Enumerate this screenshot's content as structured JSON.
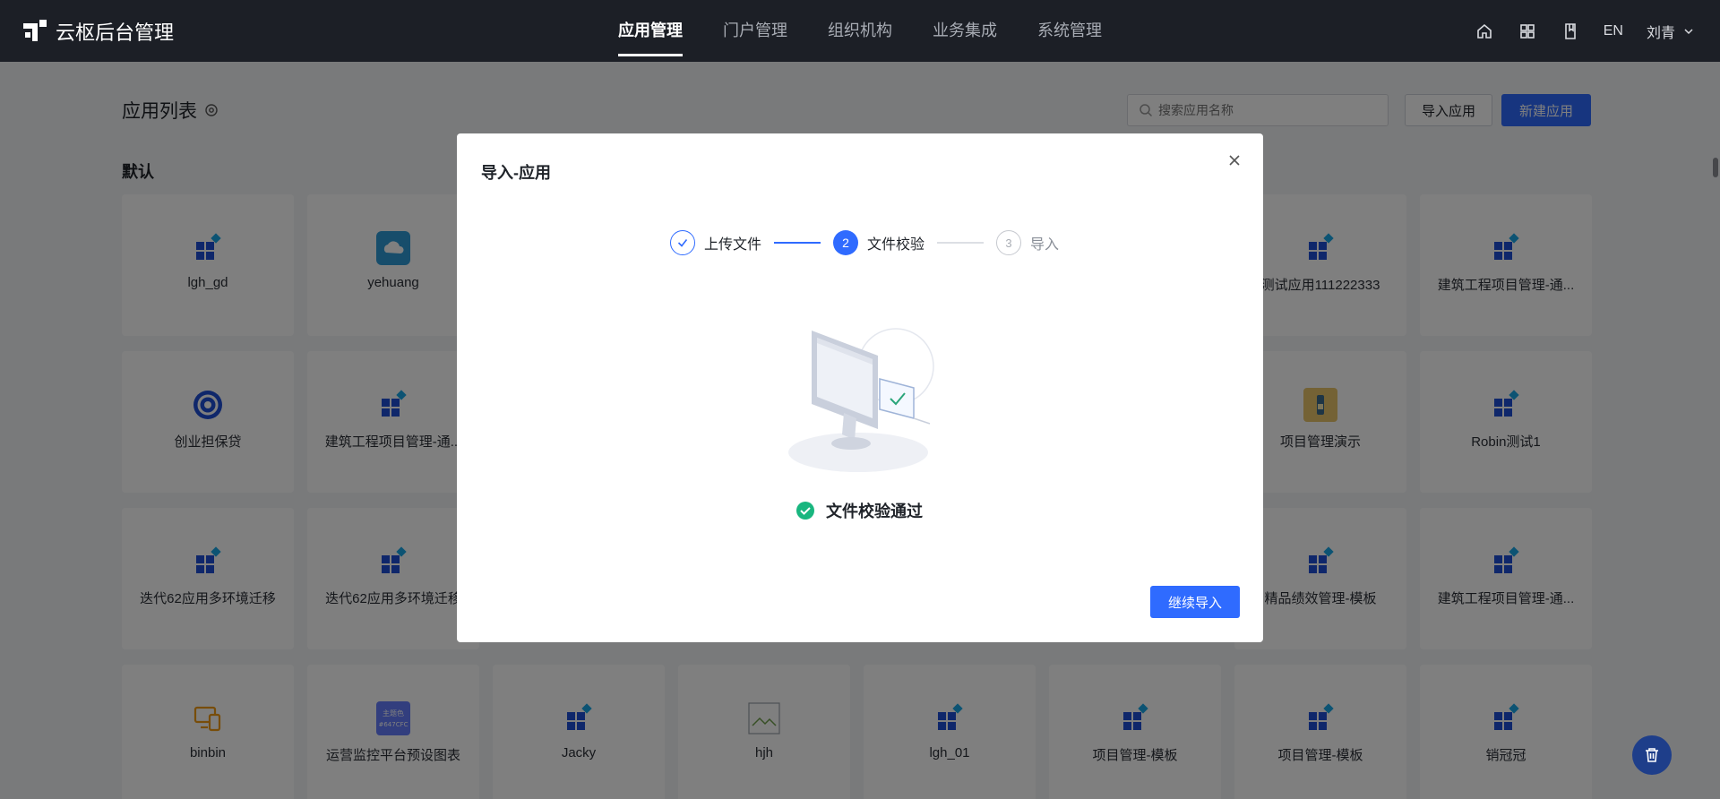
{
  "app": {
    "title": "云枢后台管理"
  },
  "topnav": [
    {
      "label": "应用管理",
      "active": true
    },
    {
      "label": "门户管理",
      "active": false
    },
    {
      "label": "组织机构",
      "active": false
    },
    {
      "label": "业务集成",
      "active": false
    },
    {
      "label": "系统管理",
      "active": false
    }
  ],
  "top_right": {
    "lang": "EN",
    "user": "刘青",
    "icons": [
      "home-icon",
      "grid-apps-icon",
      "book-icon"
    ]
  },
  "page": {
    "title": "应用列表",
    "search_placeholder": "搜索应用名称",
    "import_button": "导入应用",
    "new_button": "新建应用",
    "section": "默认"
  },
  "apps": [
    {
      "name": "lgh_gd",
      "icon": "app-grid-icon"
    },
    {
      "name": "yehuang",
      "icon": "cloud-icon"
    },
    {
      "name": "测试应用111222333",
      "icon": "app-grid-icon"
    },
    {
      "name": "建筑工程项目管理-通...",
      "icon": "app-grid-icon"
    },
    {
      "name": "创业担保贷",
      "icon": "swirl-logo-icon"
    },
    {
      "name": "建筑工程项目管理-通...",
      "icon": "app-grid-icon"
    },
    {
      "name": "项目管理演示",
      "icon": "bottle-icon"
    },
    {
      "name": "Robin测试1",
      "icon": "app-grid-icon"
    },
    {
      "name": "迭代62应用多环境迁移",
      "icon": "app-grid-icon"
    },
    {
      "name": "迭代62应用多环境迁移",
      "icon": "app-grid-icon"
    },
    {
      "name": "精品绩效管理-模板",
      "icon": "app-grid-icon"
    },
    {
      "name": "建筑工程项目管理-通...",
      "icon": "app-grid-icon"
    },
    {
      "name": "binbin",
      "icon": "devices-icon"
    },
    {
      "name": "运营监控平台预设图表",
      "icon": "color-swatch-icon",
      "badge": "主题色\n#647CFC"
    },
    {
      "name": "Jacky",
      "icon": "app-grid-icon"
    },
    {
      "name": "hjh",
      "icon": "broken-image-icon"
    },
    {
      "name": "lgh_01",
      "icon": "app-grid-icon"
    },
    {
      "name": "项目管理-模板",
      "icon": "app-grid-icon"
    },
    {
      "name": "项目管理-模板",
      "icon": "app-grid-icon"
    },
    {
      "name": "销冠冠",
      "icon": "app-grid-icon"
    }
  ],
  "modal": {
    "title": "导入-应用",
    "steps": [
      {
        "index": "1",
        "label": "上传文件",
        "status": "done"
      },
      {
        "index": "2",
        "label": "文件校验",
        "status": "current"
      },
      {
        "index": "3",
        "label": "导入",
        "status": "pending"
      }
    ],
    "result_text": "文件校验通过",
    "continue_button": "继续导入"
  },
  "colors": {
    "primary": "#2f6bff",
    "topbar": "#1c1f26",
    "success": "#19b67f",
    "app_icon": "#1e4fd6"
  }
}
